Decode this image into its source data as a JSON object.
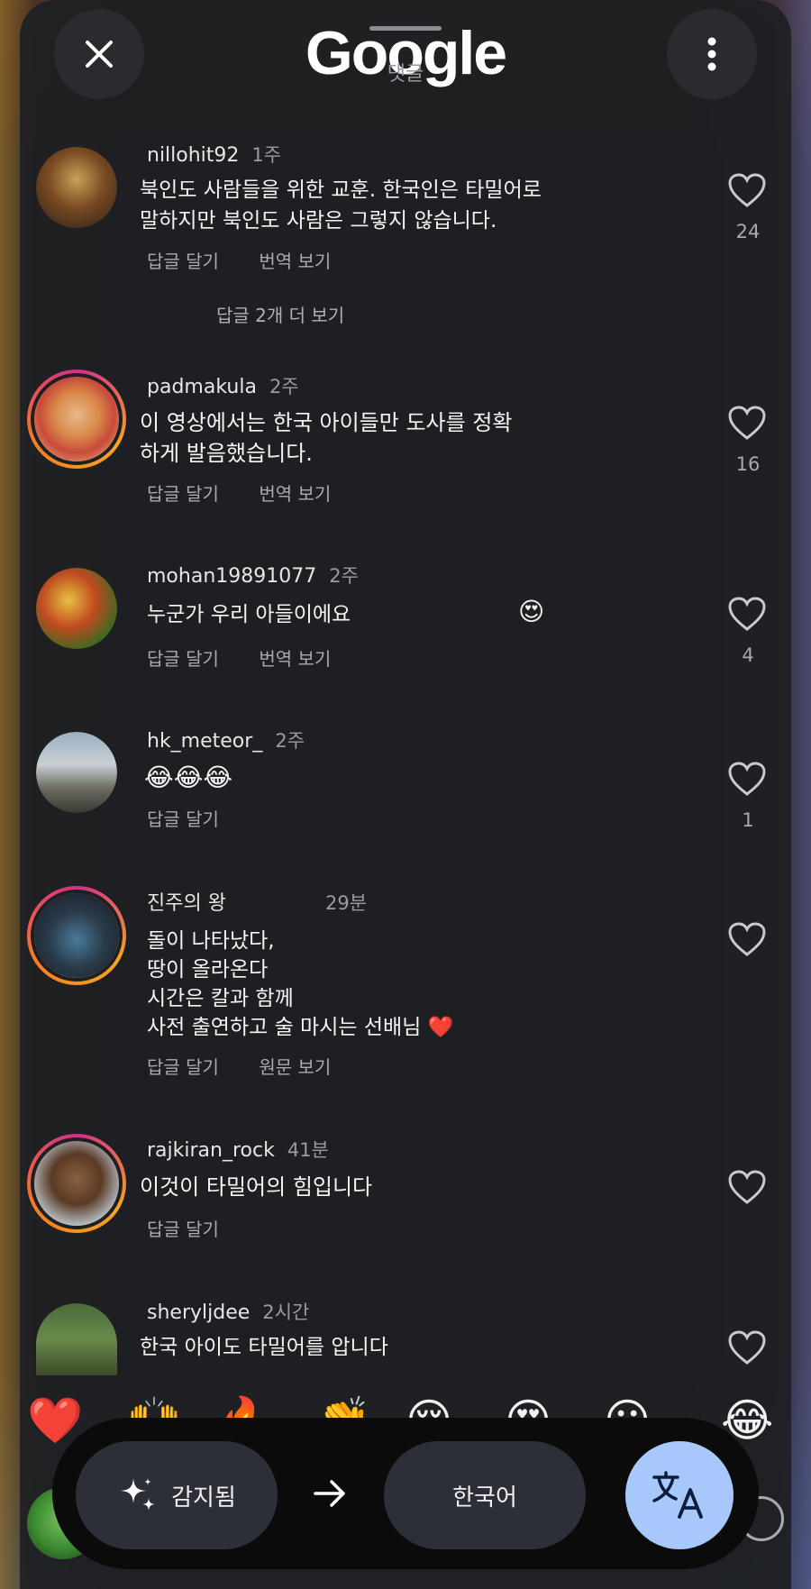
{
  "header": {
    "logo": "Google",
    "subtitle": "댓글"
  },
  "comments": [
    {
      "username": "nillohit92",
      "time": "1주",
      "text_lines": [
        "북인도 사람들을 위한 교훈. 한국인은 타밀어로",
        "말하지만 북인도 사람은 그렇지 않습니다."
      ],
      "actions": [
        "답글 달기",
        "번역 보기"
      ],
      "likes": "24",
      "replies": "답글 2개 더 보기"
    },
    {
      "username": "padmakula",
      "time": "2주",
      "text_lines": [
        "이 영상에서는 한국 아이들만 도사를 정확",
        "하게 발음했습니다."
      ],
      "actions": [
        "답글 달기",
        "번역 보기"
      ],
      "likes": "16"
    },
    {
      "username": "mohan19891077",
      "time": "2주",
      "text_lines": [
        "누군가 우리 아들이에요"
      ],
      "emoji": "😍",
      "actions": [
        "답글 달기",
        "번역 보기"
      ],
      "likes": "4"
    },
    {
      "username": "hk_meteor_",
      "time": "2주",
      "text_lines": [
        "😂😂😂"
      ],
      "actions": [
        "답글 달기"
      ],
      "likes": "1"
    },
    {
      "username": "진주의 왕",
      "time": "29분",
      "text_lines": [
        "돌이 나타났다,",
        "땅이 올라온다",
        "시간은 칼과 함께",
        "사전 출연하고 술 마시는 선배님 ❤️"
      ],
      "actions": [
        "답글 달기",
        "원문 보기"
      ],
      "likes": ""
    },
    {
      "username": "rajkiran_rock",
      "time": "41분",
      "text_lines": [
        "이것이 타밀어의 힘입니다"
      ],
      "actions": [
        "답글 달기"
      ],
      "likes": ""
    },
    {
      "username": "sheryljdee",
      "time": "2시간",
      "text_lines": [
        "한국 아이도 타밀어를 압니다"
      ],
      "actions": [],
      "likes": ""
    }
  ],
  "emoji_strip": [
    "❤️",
    "🙌",
    "🔥",
    "👏",
    "😢",
    "😍",
    "😮",
    "😂"
  ],
  "translate_bar": {
    "source_label": "감지됨",
    "target_label": "한국어"
  },
  "colors": {
    "background": "#1f2024",
    "translate_button": "#a8c7fa",
    "pill": "#2d2f38"
  }
}
